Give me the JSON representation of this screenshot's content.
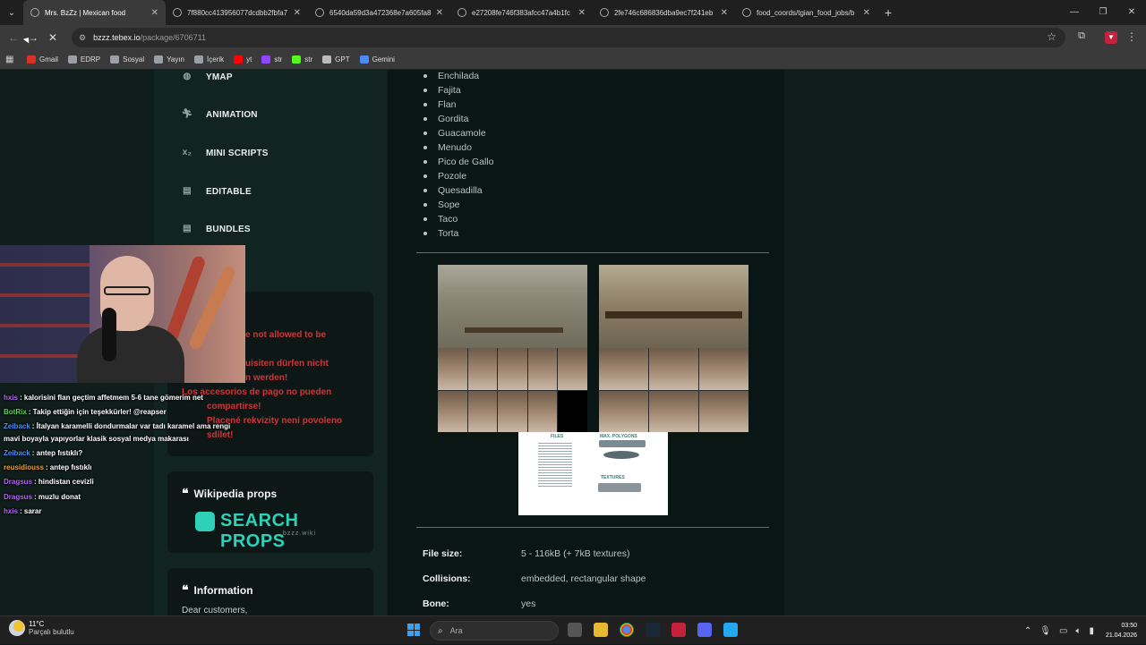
{
  "browser": {
    "tabs": [
      {
        "title": "Mrs. BzZz | Mexican food",
        "active": true
      },
      {
        "title": "7f880cc413956077dcdbb2fbfa7",
        "active": false
      },
      {
        "title": "6540da59d3a472368e7a605fa8",
        "active": false
      },
      {
        "title": "e27208fe746f383afcc47a4b1fc",
        "active": false
      },
      {
        "title": "2fe746c686836dba9ec7f241eb",
        "active": false
      },
      {
        "title": "food_coords/tgian_food_jobs/b",
        "active": false
      }
    ],
    "url_host": "bzzz.tebex.io",
    "url_path": "/package/6706711",
    "bookmarks": [
      "Gmail",
      "EDRP",
      "Sosyal",
      "Yayın",
      "İçerik",
      "yt",
      "str",
      "str",
      "GPT",
      "Gemini"
    ],
    "bookmark_colors": [
      "#d93025",
      "#9aa0a6",
      "#9aa0a6",
      "#9aa0a6",
      "#9aa0a6",
      "#ff0000",
      "#9146ff",
      "#53fc18",
      "#bbbbbb",
      "#4c8bf5"
    ]
  },
  "sidebar": {
    "items": [
      {
        "label": "YMAP",
        "icon": "globe-icon"
      },
      {
        "label": "ANIMATION",
        "icon": "running-person-icon"
      },
      {
        "label": "MINI SCRIPTS",
        "icon": "subscript-icon"
      },
      {
        "label": "EDITABLE",
        "icon": "archive-icon"
      },
      {
        "label": "BUNDLES",
        "icon": "archive-icon"
      }
    ],
    "warning_lines": [
      "e not allowed to be",
      "uisiten dürfen nicht",
      "n werden!",
      "Los accesorios de pago no pueden",
      "compartirse!",
      "Placené rekvizity není povoleno",
      "sdílet!"
    ],
    "wiki_card": {
      "title": "Wikipedia props",
      "banner_text": "SEARCH PROPS",
      "banner_sub": "bzzz.wiki"
    },
    "info_card": {
      "title": "Information",
      "body": "Dear customers,"
    }
  },
  "main": {
    "food_items": [
      "Enchilada",
      "Fajita",
      "Flan",
      "Gordita",
      "Guacamole",
      "Menudo",
      "Pico de Gallo",
      "Pozole",
      "Quesadilla",
      "Sope",
      "Taco",
      "Torta"
    ],
    "image_labels": {
      "files": "FILES",
      "max_polygons": "MAX. POLYGONS",
      "textures": "TEXTURES"
    },
    "specs": [
      {
        "key": "File size:",
        "value": "5 - 116kB (+ 7kB textures)"
      },
      {
        "key": "Collisions:",
        "value": "embedded, rectangular shape"
      },
      {
        "key": "Bone:",
        "value": "yes"
      }
    ]
  },
  "chat": [
    {
      "user": "hxis",
      "text": ": kalorisini flan geçtim affetmem 5-6 tane gömerim net",
      "color": "#b565f0"
    },
    {
      "user": "BotRix",
      "text": ": Takip ettiğin için teşekkürler! @reapser",
      "color": "#5ad45a"
    },
    {
      "user": "Zeiback",
      "text": ": İtalyan karamelli dondurmalar var tadı karamel ama rengi",
      "color": "#4b8ef0"
    },
    {
      "user": "",
      "text": "mavi boyayla yapıyorlar klasik sosyal medya makarası",
      "color": "#ffffff"
    },
    {
      "user": "Zeiback",
      "text": ": antep fıstıklı?",
      "color": "#4b8ef0"
    },
    {
      "user": "reusidiouss",
      "text": ": antep fıstıklı",
      "color": "#f0a030"
    },
    {
      "user": "Dragsus",
      "text": ": hindistan cevizli",
      "color": "#b565f0"
    },
    {
      "user": "Dragsus",
      "text": ": muzlu donat",
      "color": "#b565f0"
    },
    {
      "user": "hxis",
      "text": ": sarar",
      "color": "#b565f0"
    }
  ],
  "taskbar": {
    "temperature": "11°C",
    "weather": "Parçalı bulutlu",
    "search_placeholder": "Ara",
    "time": "03:50",
    "date": "21.04.2026"
  }
}
